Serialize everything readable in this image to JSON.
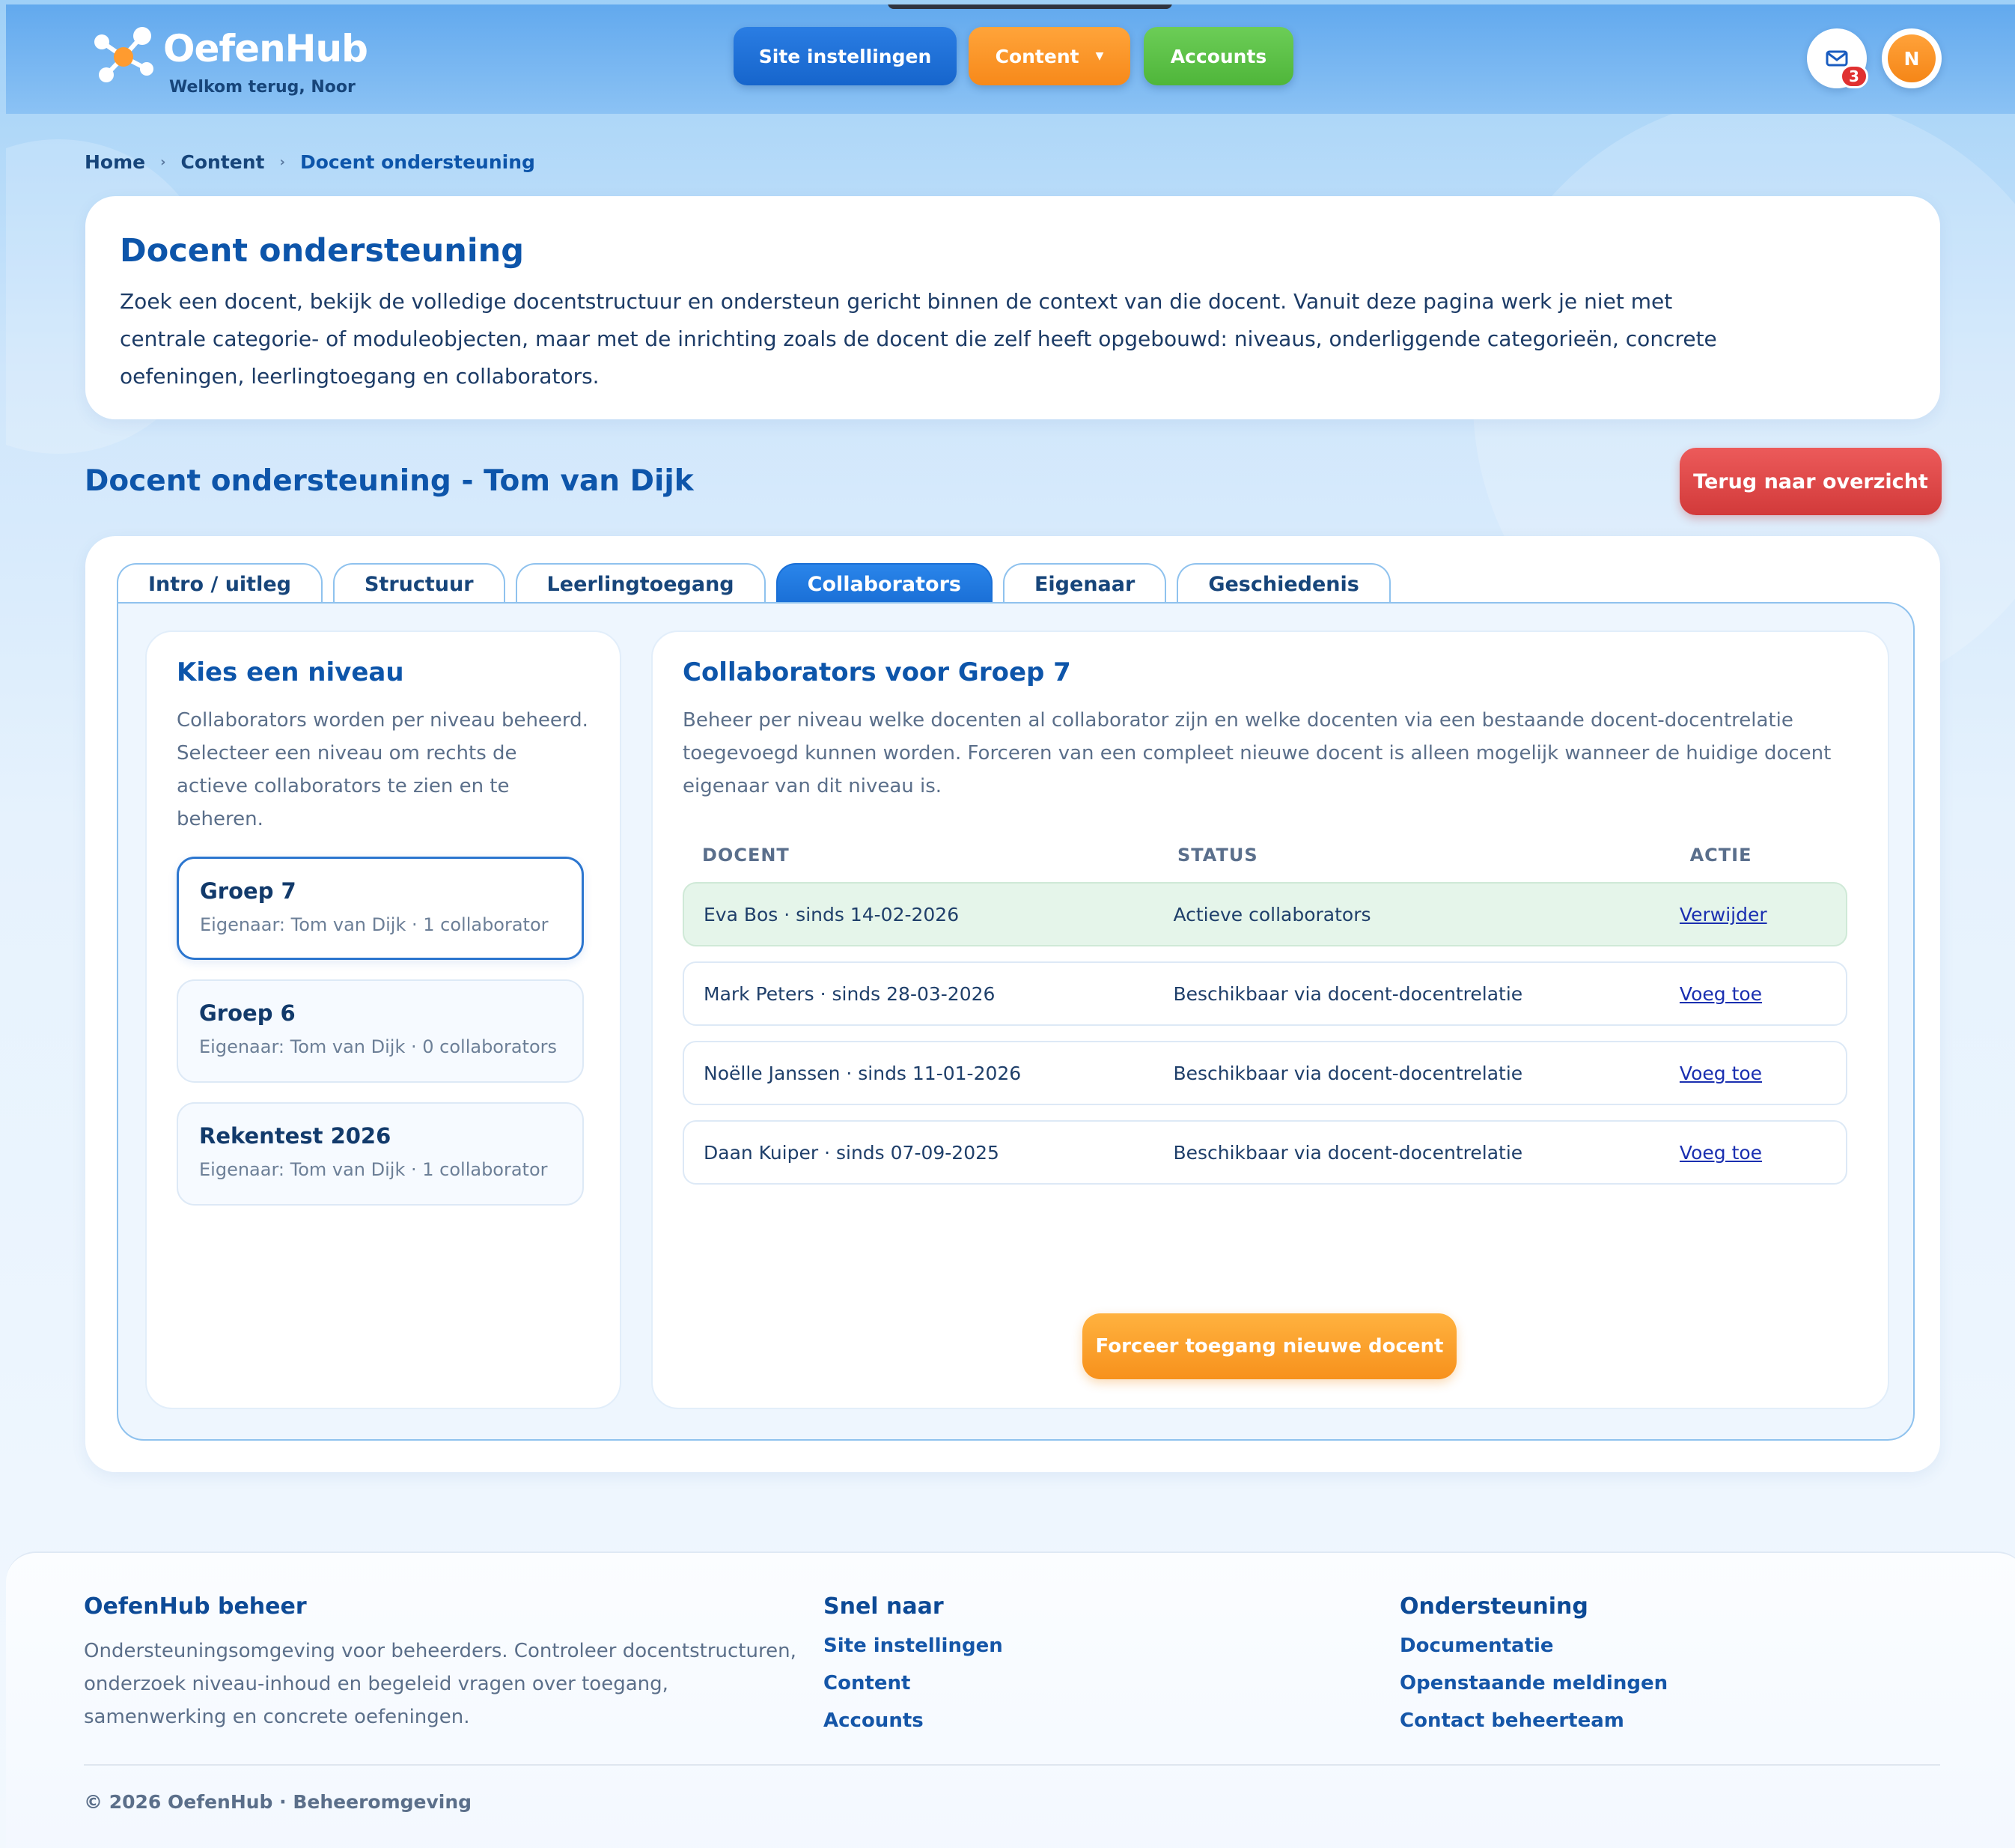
{
  "header": {
    "app_name": "OefenHub",
    "welcome": "Welkom terug, Noor",
    "nav": {
      "site_settings": "Site instellingen",
      "content": "Content",
      "accounts": "Accounts"
    },
    "mail_badge": "3",
    "avatar_initial": "N"
  },
  "breadcrumb": {
    "home": "Home",
    "content": "Content",
    "current": "Docent ondersteuning"
  },
  "intro": {
    "title": "Docent ondersteuning",
    "text": "Zoek een docent, bekijk de volledige docentstructuur en ondersteun gericht binnen de context van die docent. Vanuit deze pagina werk je niet met centrale categorie- of moduleobjecten, maar met de inrichting zoals de docent die zelf heeft opgebouwd: niveaus, onderliggende categorieën, concrete oefeningen, leerlingtoegang en collaborators."
  },
  "section": {
    "title": "Docent ondersteuning - Tom van Dijk",
    "back_button": "Terug naar overzicht"
  },
  "tabs": [
    {
      "label": "Intro / uitleg"
    },
    {
      "label": "Structuur"
    },
    {
      "label": "Leerlingtoegang"
    },
    {
      "label": "Collaborators"
    },
    {
      "label": "Eigenaar"
    },
    {
      "label": "Geschiedenis"
    }
  ],
  "levels": {
    "title": "Kies een niveau",
    "description": "Collaborators worden per niveau beheerd. Selecteer een niveau om rechts de actieve collaborators te zien en te beheren.",
    "items": [
      {
        "name": "Groep 7",
        "meta": "Eigenaar: Tom van Dijk · 1 collaborator"
      },
      {
        "name": "Groep 6",
        "meta": "Eigenaar: Tom van Dijk · 0 collaborators"
      },
      {
        "name": "Rekentest 2026",
        "meta": "Eigenaar: Tom van Dijk · 1 collaborator"
      }
    ]
  },
  "collaborators": {
    "title": "Collaborators voor Groep 7",
    "description": "Beheer per niveau welke docenten al collaborator zijn en welke docenten via een bestaande docent-docentrelatie toegevoegd kunnen worden. Forceren van een compleet nieuwe docent is alleen mogelijk wanneer de huidige docent eigenaar van dit niveau is.",
    "columns": {
      "docent": "DOCENT",
      "status": "STATUS",
      "actie": "ACTIE"
    },
    "rows": [
      {
        "docent": "Eva Bos · sinds 14-02-2026",
        "status": "Actieve collaborators",
        "actie": "Verwijder"
      },
      {
        "docent": "Mark Peters · sinds 28-03-2026",
        "status": "Beschikbaar via docent-docentrelatie",
        "actie": "Voeg toe"
      },
      {
        "docent": "Noëlle Janssen · sinds 11-01-2026",
        "status": "Beschikbaar via docent-docentrelatie",
        "actie": "Voeg toe"
      },
      {
        "docent": "Daan Kuiper · sinds 07-09-2025",
        "status": "Beschikbaar via docent-docentrelatie",
        "actie": "Voeg toe"
      }
    ],
    "force_button": "Forceer toegang nieuwe docent"
  },
  "footer": {
    "about_title": "OefenHub beheer",
    "about_text": "Ondersteuningsomgeving voor beheerders. Controleer docentstructuren, onderzoek niveau-inhoud en begeleid vragen over toegang, samenwerking en concrete oefeningen.",
    "quick_title": "Snel naar",
    "quick_links": [
      "Site instellingen",
      "Content",
      "Accounts"
    ],
    "support_title": "Ondersteuning",
    "support_links": [
      "Documentatie",
      "Openstaande meldingen",
      "Contact beheerteam"
    ],
    "copyright": "© 2026 OefenHub · Beheeromgeving"
  }
}
